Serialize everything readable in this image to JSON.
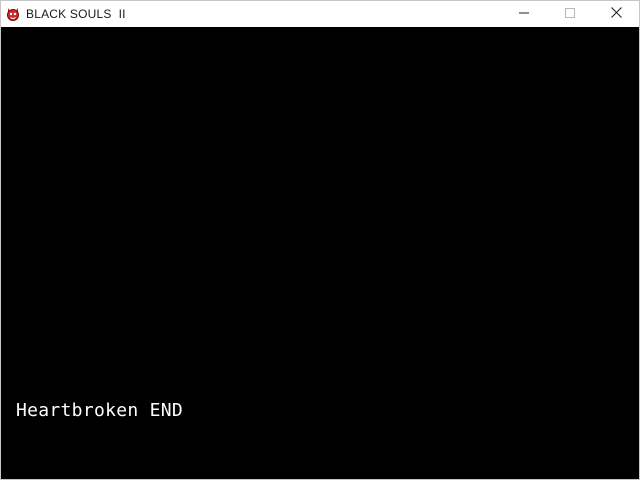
{
  "window": {
    "title": "BLACK SOULS  II",
    "app_icon": "red-demon-head-icon",
    "controls": {
      "minimize_icon": "minimize-icon",
      "maximize_icon": "maximize-icon",
      "close_icon": "close-icon"
    }
  },
  "game": {
    "ending_text": "Heartbroken END",
    "background_color": "#000000",
    "text_color": "#ffffff"
  }
}
